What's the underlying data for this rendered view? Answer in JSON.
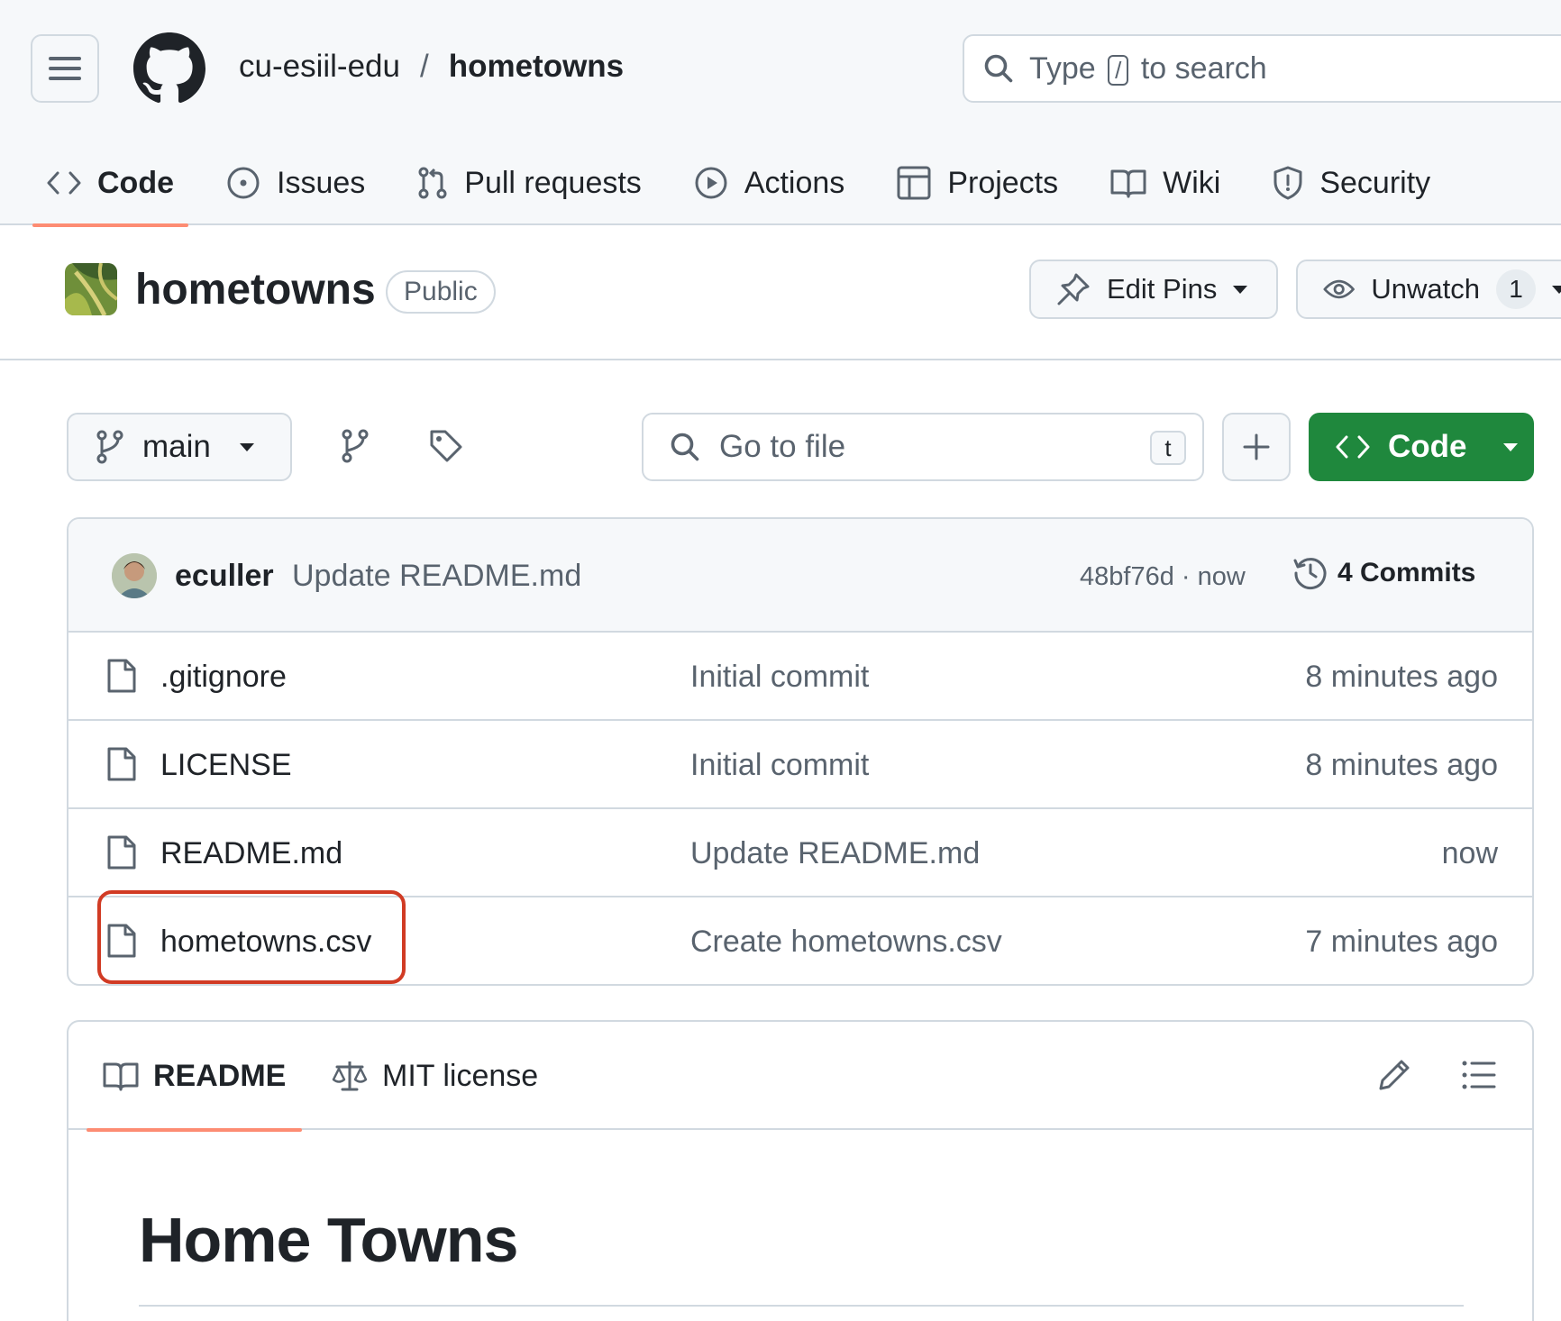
{
  "header": {
    "owner": "cu-esiil-edu",
    "separator": "/",
    "repo": "hometowns",
    "search": {
      "prefix": "Type",
      "key": "/",
      "suffix": "to search"
    }
  },
  "nav_tabs": [
    {
      "label": "Code",
      "icon": "code-icon",
      "active": true
    },
    {
      "label": "Issues",
      "icon": "issue-icon"
    },
    {
      "label": "Pull requests",
      "icon": "pull-request-icon"
    },
    {
      "label": "Actions",
      "icon": "play-icon"
    },
    {
      "label": "Projects",
      "icon": "table-icon"
    },
    {
      "label": "Wiki",
      "icon": "book-icon"
    },
    {
      "label": "Security",
      "icon": "shield-icon"
    }
  ],
  "repo": {
    "title": "hometowns",
    "visibility": "Public",
    "edit_pins_label": "Edit Pins",
    "unwatch_label": "Unwatch",
    "watch_count": "1"
  },
  "toolbar": {
    "branch": "main",
    "go_to_file_placeholder": "Go to file",
    "go_to_file_key": "t",
    "code_label": "Code"
  },
  "latest_commit": {
    "user": "eculler",
    "message": "Update README.md",
    "sha_time": "48bf76d · now",
    "commits_label": "4 Commits"
  },
  "files": [
    {
      "name": ".gitignore",
      "commit": "Initial commit",
      "time": "8 minutes ago"
    },
    {
      "name": "LICENSE",
      "commit": "Initial commit",
      "time": "8 minutes ago"
    },
    {
      "name": "README.md",
      "commit": "Update README.md",
      "time": "now"
    },
    {
      "name": "hometowns.csv",
      "commit": "Create hometowns.csv",
      "time": "7 minutes ago"
    }
  ],
  "readme": {
    "tab_readme": "README",
    "tab_license": "MIT license",
    "heading": "Home Towns"
  },
  "colors": {
    "accent_tab": "#fd8c73",
    "code_button": "#1f883d",
    "highlight_box": "#d13b24"
  }
}
